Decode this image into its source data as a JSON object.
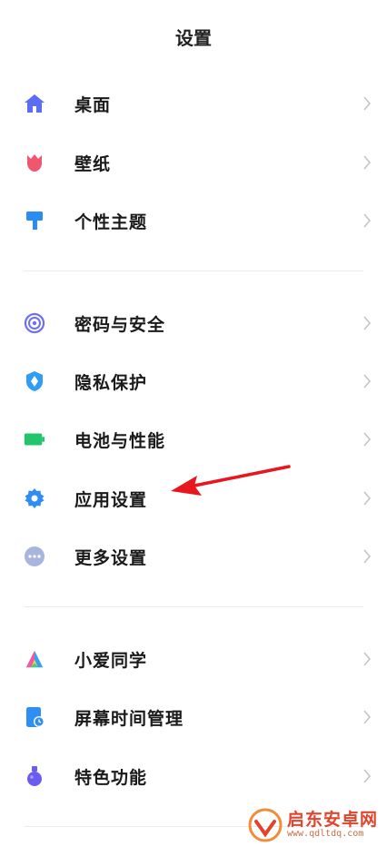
{
  "header": {
    "title": "设置"
  },
  "groups": [
    {
      "items": [
        {
          "label": "桌面",
          "icon": "home-icon",
          "color": "#5b6cf5"
        },
        {
          "label": "壁纸",
          "icon": "tulip-icon",
          "color": "#f0566e"
        },
        {
          "label": "个性主题",
          "icon": "brush-icon",
          "color": "#2b8cf5"
        }
      ]
    },
    {
      "items": [
        {
          "label": "密码与安全",
          "icon": "fingerprint-icon",
          "color": "#6c6ff3"
        },
        {
          "label": "隐私保护",
          "icon": "shield-icon",
          "color": "#2f9cf6"
        },
        {
          "label": "电池与性能",
          "icon": "battery-icon",
          "color": "#22c56b"
        },
        {
          "label": "应用设置",
          "icon": "gear-icon",
          "color": "#2f8ef6"
        },
        {
          "label": "更多设置",
          "icon": "more-icon",
          "color": "#a8b5dd"
        }
      ]
    },
    {
      "items": [
        {
          "label": "小爱同学",
          "icon": "xiaoai-icon",
          "color": "#f05aa0"
        },
        {
          "label": "屏幕时间管理",
          "icon": "screen-time-icon",
          "color": "#2f8ef6"
        },
        {
          "label": "特色功能",
          "icon": "flask-icon",
          "color": "#6b5cf0"
        }
      ]
    }
  ],
  "annotation": {
    "arrow_color": "#e8161d"
  },
  "watermark": {
    "title": "启东安卓网",
    "url": "www.qdltdq.com"
  }
}
